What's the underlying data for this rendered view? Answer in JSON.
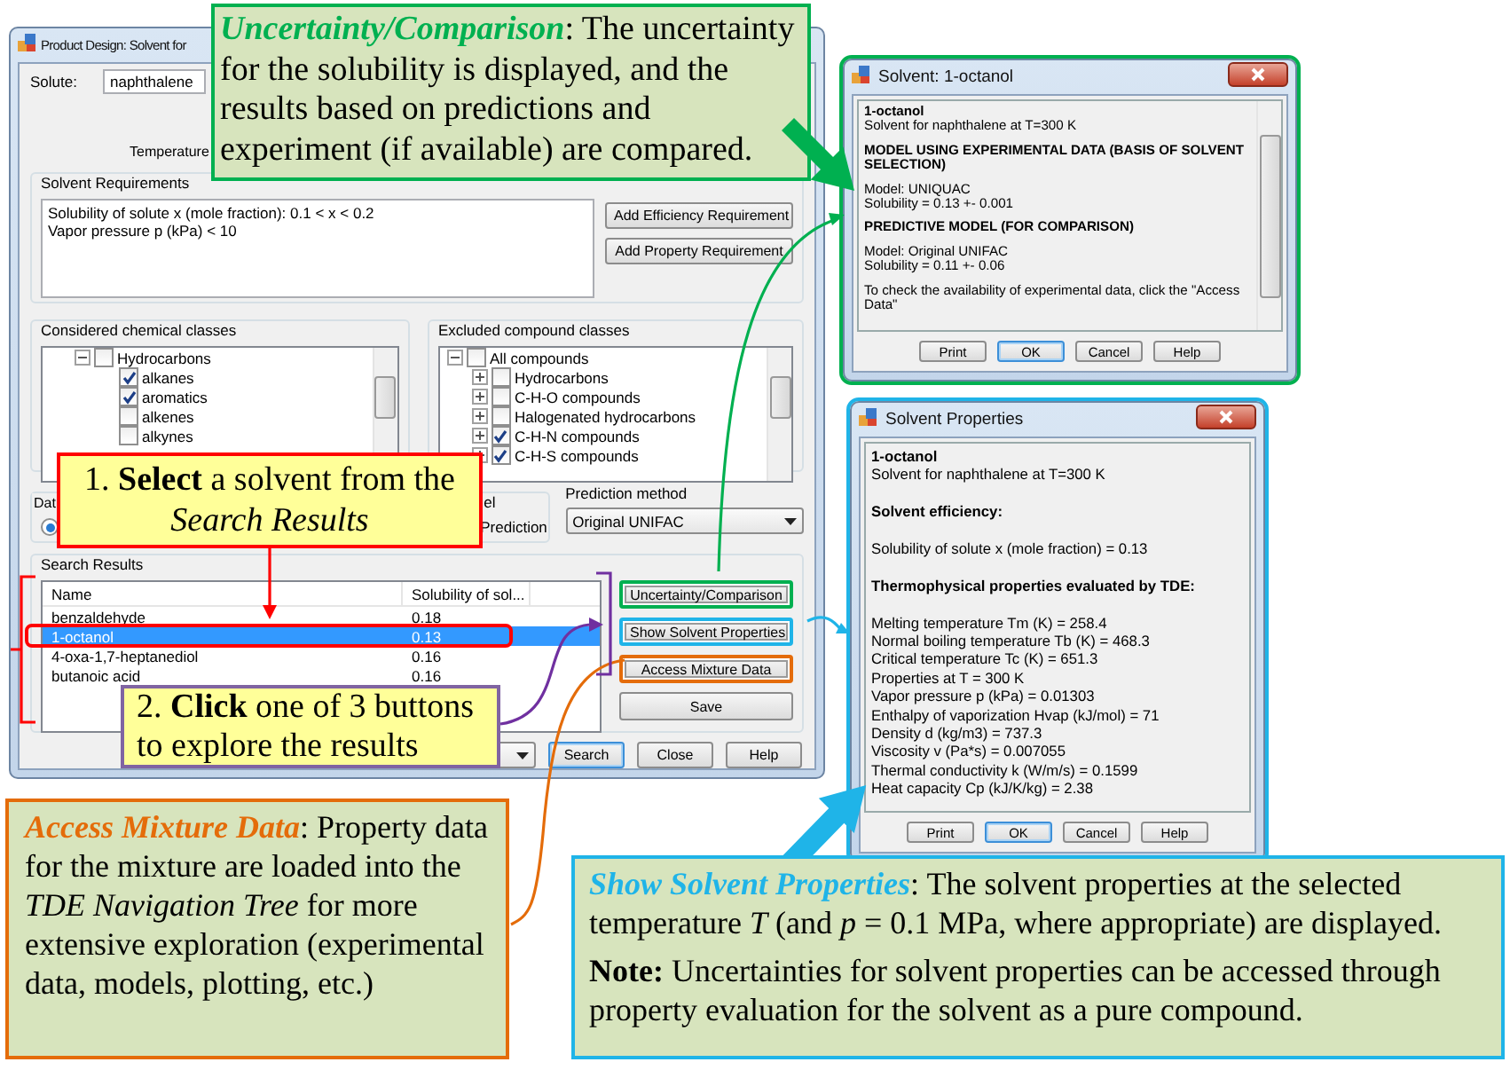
{
  "main_window": {
    "title": "Product Design: Solvent for",
    "solute_label": "Solute:",
    "solute": "naphthalene",
    "temperature_label": "Temperature",
    "requirements": {
      "title": "Solvent Requirements",
      "lines": [
        "Solubility of solute x (mole fraction): 0.1 < x < 0.2",
        "Vapor pressure p (kPa) < 10"
      ],
      "buttons": [
        "Add Efficiency Requirement",
        "Add Property Requirement"
      ]
    },
    "considered_classes": {
      "title": "Considered chemical classes",
      "tree": [
        {
          "label": "Hydrocarbons",
          "checked": false,
          "expanded": true,
          "children": [
            {
              "label": "alkanes",
              "checked": true
            },
            {
              "label": "aromatics",
              "checked": true
            },
            {
              "label": "alkenes",
              "checked": false
            },
            {
              "label": "alkynes",
              "checked": false
            }
          ]
        }
      ]
    },
    "excluded_classes": {
      "title": "Excluded compound classes",
      "tree": [
        {
          "label": "All compounds",
          "checked": false,
          "expanded": true,
          "children": [
            {
              "label": "Hydrocarbons",
              "checked": false,
              "expanded": false
            },
            {
              "label": "C-H-O compounds",
              "checked": false,
              "expanded": false
            },
            {
              "label": "Halogenated hydrocarbons",
              "checked": false,
              "expanded": false
            },
            {
              "label": "C-H-N compounds",
              "checked": true,
              "expanded": false
            },
            {
              "label": "C-H-S compounds",
              "checked": true,
              "expanded": false
            }
          ]
        }
      ]
    },
    "data_group": {
      "title": "Dat",
      "options": [
        {
          "selected": true
        }
      ]
    },
    "model_group": {
      "title": "el",
      "option_label": "Prediction"
    },
    "prediction_method": {
      "label": "Prediction method",
      "value": "Original UNIFAC"
    },
    "search_results": {
      "title": "Search Results",
      "columns": [
        "Name",
        "Solubility of sol..."
      ],
      "rows": [
        {
          "cells": [
            "benzaldehyde",
            "0.18"
          ],
          "selected": false
        },
        {
          "cells": [
            "1-octanol",
            "0.13"
          ],
          "selected": true
        },
        {
          "cells": [
            "4-oxa-1,7-heptanediol",
            "0.16"
          ],
          "selected": false
        },
        {
          "cells": [
            "butanoic acid",
            "0.16"
          ],
          "selected": false
        }
      ]
    },
    "result_buttons": [
      {
        "label": "Uncertainty/Comparison",
        "color": "#00b050"
      },
      {
        "label": "Show Solvent Properties",
        "color": "#1fb4e8"
      },
      {
        "label": "Access Mixture Data",
        "color": "#e46c0a"
      },
      {
        "label": "Save"
      }
    ],
    "bottom_buttons": [
      {
        "label": "Search",
        "focused": true
      },
      {
        "label": "Close",
        "focused": false
      },
      {
        "label": "Help",
        "focused": false
      }
    ]
  },
  "uncertainty_dialog": {
    "title": "Solvent: 1-octanol",
    "paragraphs": [
      [
        {
          "text": "1-octanol",
          "bold": true
        },
        {
          "text": "Solvent for naphthalene at T=300 K",
          "bold": false
        }
      ],
      [
        {
          "text": "MODEL USING EXPERIMENTAL DATA (BASIS OF SOLVENT SELECTION)",
          "bold": true
        }
      ],
      [
        {
          "text": "Model: UNIQUAC",
          "bold": false
        },
        {
          "text": "Solubility = 0.13 +- 0.001",
          "bold": false
        }
      ],
      [
        {
          "text": "PREDICTIVE MODEL (FOR COMPARISON)",
          "bold": true
        }
      ],
      [
        {
          "text": "Model: Original UNIFAC",
          "bold": false
        },
        {
          "text": "Solubility = 0.11 +- 0.06",
          "bold": false
        }
      ],
      [
        {
          "text": "To check the availability of experimental data, click the \"Access Data\"",
          "bold": false
        }
      ]
    ],
    "buttons": [
      {
        "label": "Print",
        "focused": false
      },
      {
        "label": "OK",
        "focused": true
      },
      {
        "label": "Cancel",
        "focused": false
      },
      {
        "label": "Help",
        "focused": false
      }
    ]
  },
  "properties_dialog": {
    "title": "Solvent Properties",
    "paragraphs": [
      [
        {
          "text": "1-octanol",
          "bold": true
        },
        {
          "text": "Solvent for naphthalene at T=300 K",
          "bold": false
        }
      ],
      [
        {
          "text": "Solvent efficiency:",
          "bold": true
        }
      ],
      [
        {
          "text": "Solubility of solute x (mole fraction) = 0.13",
          "bold": false
        }
      ],
      [
        {
          "text": "Thermophysical properties evaluated by TDE:",
          "bold": true
        }
      ],
      [
        {
          "text": "Melting temperature Tm (K) = 258.4",
          "bold": false
        },
        {
          "text": "Normal boiling temperature Tb (K) = 468.3",
          "bold": false
        },
        {
          "text": "Critical temperature Tc (K) = 651.3",
          "bold": false
        },
        {
          "text": "Properties at T = 300 K",
          "bold": false
        },
        {
          "text": "Vapor pressure p (kPa) = 0.01303",
          "bold": false
        },
        {
          "text": "Enthalpy of vaporization Hvap (kJ/mol) = 71",
          "bold": false
        },
        {
          "text": "Density d (kg/m3) = 737.3",
          "bold": false
        },
        {
          "text": "Viscosity v (Pa*s) = 0.007055",
          "bold": false
        },
        {
          "text": "Thermal conductivity k (W/m/s) = 0.1599",
          "bold": false
        },
        {
          "text": "Heat capacity Cp (kJ/K/kg) = 2.38",
          "bold": false
        }
      ]
    ],
    "buttons": [
      {
        "label": "Print",
        "focused": false
      },
      {
        "label": "OK",
        "focused": true
      },
      {
        "label": "Cancel",
        "focused": false
      },
      {
        "label": "Help",
        "focused": false
      }
    ]
  },
  "callouts": [
    {
      "kind": "explanation",
      "color": "#00b050",
      "paragraphs": [
        "**Uncertainty/Comparison**: The uncertainty for the solubility is displayed, and the results based on predictions and experiment (if available) are compared."
      ]
    },
    {
      "kind": "step",
      "color": "#ff0000",
      "paragraphs": [
        "1. **Select** a solvent from the *Search Results*"
      ]
    },
    {
      "kind": "step",
      "color": "#8064a2",
      "paragraphs": [
        "2. **Click** one of 3 buttons to explore the results"
      ]
    },
    {
      "kind": "explanation",
      "color": "#e46c0a",
      "paragraphs": [
        "**Access Mixture Data**: Property data for the mixture are loaded into the *TDE Navigation Tree* for more extensive exploration (experimental data, models, plotting, etc.)"
      ]
    },
    {
      "kind": "explanation",
      "color": "#1fb4e8",
      "paragraphs": [
        "**Show Solvent Properties**: The solvent properties at the selected temperature *T* (and *p* = 0.1 MPa, where appropriate) are displayed.",
        "**Note:** Uncertainties for solvent properties can be accessed through property evaluation for the solvent as a pure compound."
      ]
    }
  ]
}
